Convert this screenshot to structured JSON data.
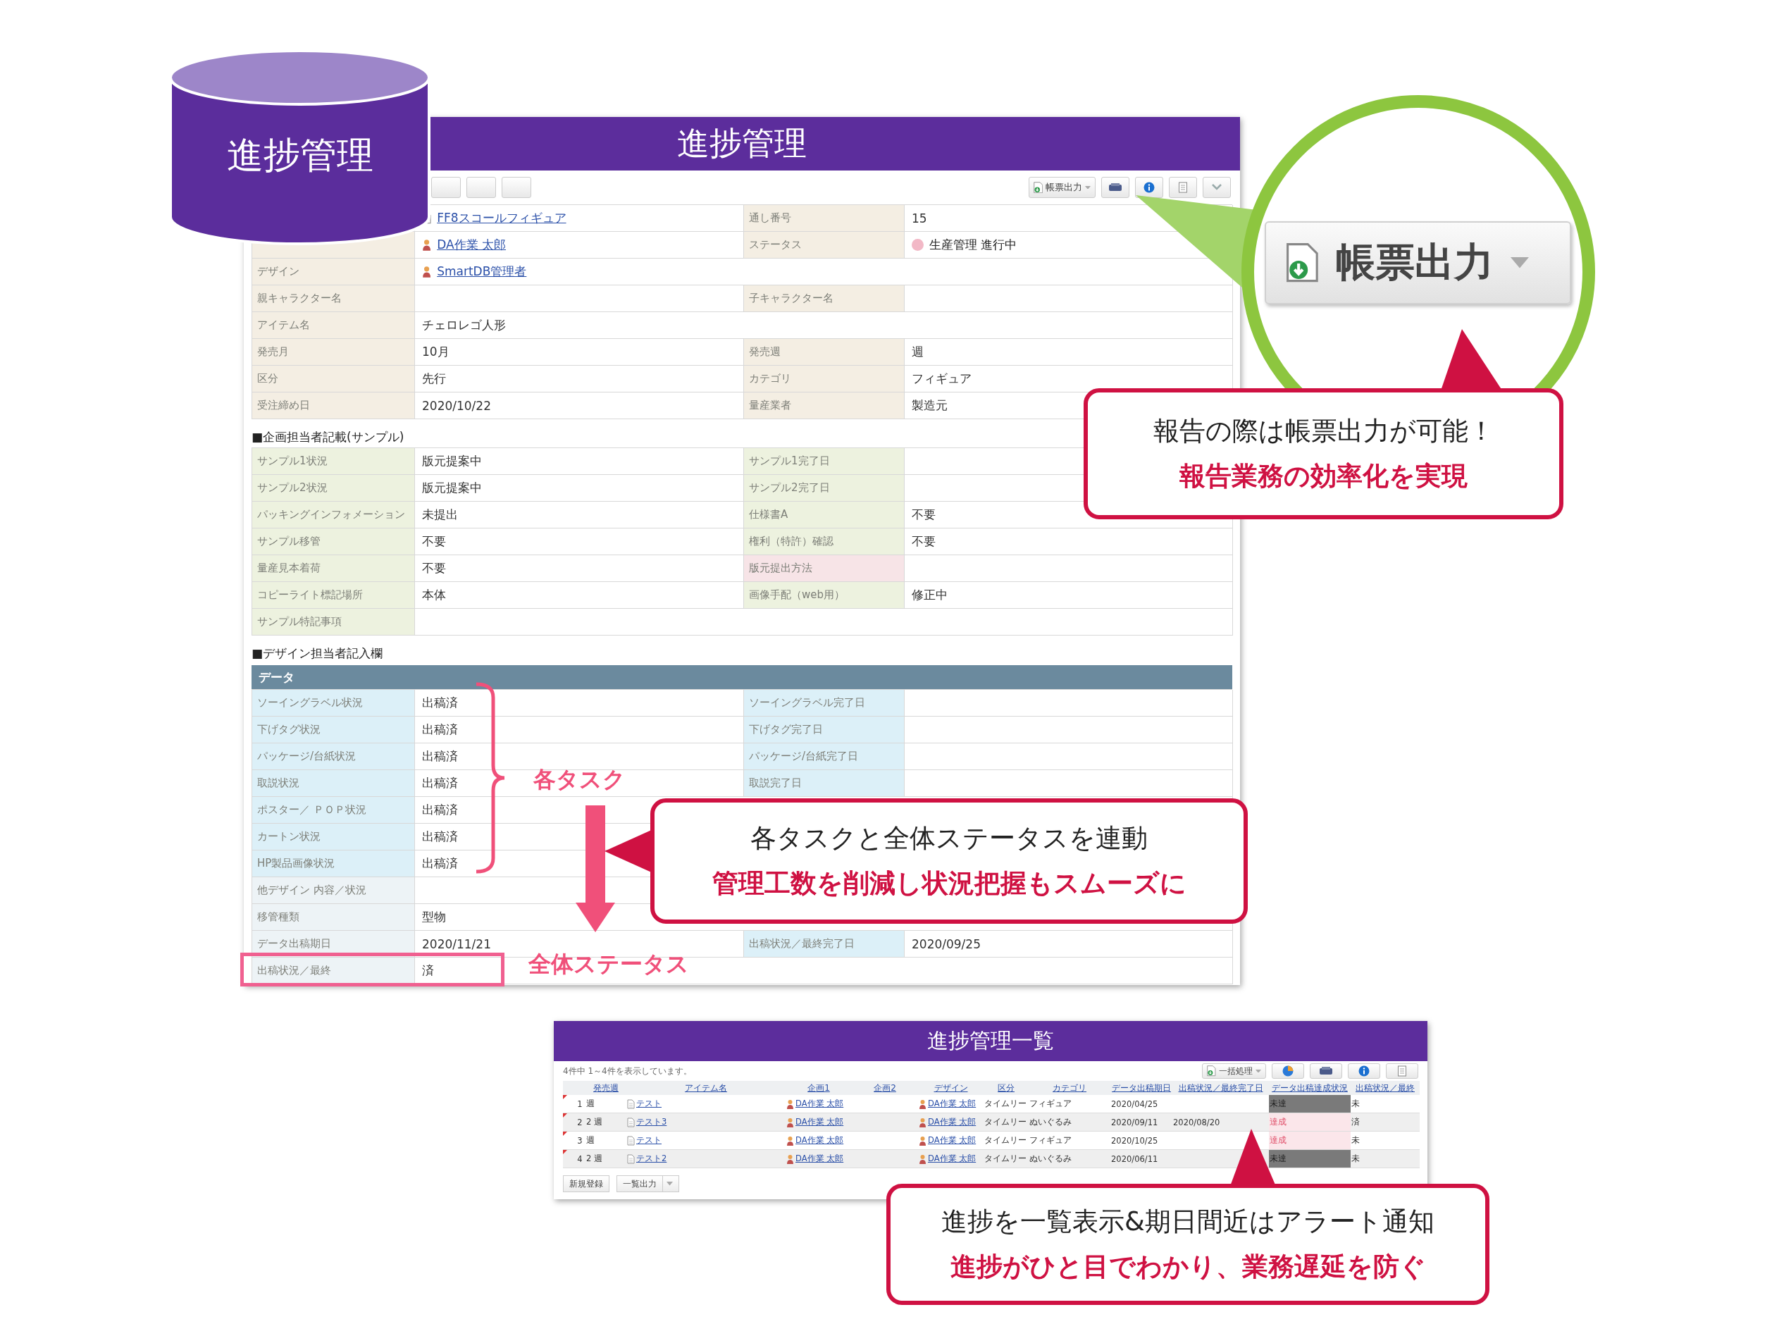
{
  "badge": {
    "title": "進捗管理"
  },
  "form": {
    "title": "進捗管理",
    "toolbar": {
      "left": [
        {
          "kind": "plain"
        },
        {
          "kind": "plain"
        },
        {
          "kind": "plain"
        }
      ],
      "right": [
        {
          "kind": "report",
          "label": "帳票出力"
        },
        {
          "kind": "print"
        },
        {
          "kind": "info"
        },
        {
          "kind": "doc"
        },
        {
          "kind": "chevron"
        }
      ]
    },
    "sections": [
      {
        "rows": [
          {
            "cells": [
              {
                "kind": "label"
              },
              {
                "kind": "doc_link",
                "text": "FF8スコールフィギュア"
              },
              {
                "kind": "label",
                "text": "通し番号",
                "color": "#f4eee3"
              },
              {
                "kind": "text",
                "text": "15"
              }
            ]
          },
          {
            "cells": [
              {
                "kind": "label",
                "color": "#f4eee3"
              },
              {
                "kind": "person_link",
                "text": "DA作業 太郎"
              },
              {
                "kind": "label",
                "text": "ステータス",
                "color": "#f4eee3"
              },
              {
                "kind": "status",
                "text": "生産管理 進行中",
                "color": "#f2b8c6"
              }
            ]
          },
          {
            "cells": [
              {
                "kind": "label",
                "text": "デザイン",
                "color": "#f4eee3"
              },
              {
                "kind": "person_link",
                "text": "SmartDB管理者"
              }
            ]
          },
          {
            "cells": [
              {
                "kind": "label",
                "text": "親キャラクター名",
                "color": "#f4eee3"
              },
              {
                "kind": "empty"
              },
              {
                "kind": "label",
                "text": "子キャラクター名",
                "color": "#f4eee3"
              },
              {
                "kind": "empty"
              }
            ]
          },
          {
            "cells": [
              {
                "kind": "label",
                "text": "アイテム名",
                "color": "#f4eee3"
              },
              {
                "kind": "text",
                "text": "チェロレゴ人形"
              }
            ]
          },
          {
            "cells": [
              {
                "kind": "label",
                "text": "発売月",
                "color": "#f4eee3"
              },
              {
                "kind": "text",
                "text": "10月"
              },
              {
                "kind": "label",
                "text": "発売週",
                "color": "#f4eee3"
              },
              {
                "kind": "text",
                "text": "週"
              }
            ]
          },
          {
            "cells": [
              {
                "kind": "label",
                "text": "区分",
                "color": "#f4eee3"
              },
              {
                "kind": "text",
                "text": "先行"
              },
              {
                "kind": "label",
                "text": "カテゴリ",
                "color": "#f4eee3"
              },
              {
                "kind": "text",
                "text": "フィギュア"
              }
            ]
          },
          {
            "cells": [
              {
                "kind": "label",
                "text": "受注締め日",
                "color": "#f4eee3"
              },
              {
                "kind": "text",
                "text": "2020/10/22"
              },
              {
                "kind": "label",
                "text": "量産業者",
                "color": "#f4eee3"
              },
              {
                "kind": "text",
                "text": "製造元"
              }
            ]
          }
        ]
      },
      {
        "heading": "■企画担当者記載(サンプル)",
        "rows": [
          {
            "cells": [
              {
                "kind": "label",
                "text": "サンプル1状況",
                "color": "#edf2df"
              },
              {
                "kind": "text",
                "text": "版元提案中"
              },
              {
                "kind": "label",
                "text": "サンプル1完了日",
                "color": "#edf2df"
              },
              {
                "kind": "empty"
              }
            ]
          },
          {
            "cells": [
              {
                "kind": "label",
                "text": "サンプル2状況",
                "color": "#edf2df"
              },
              {
                "kind": "text",
                "text": "版元提案中"
              },
              {
                "kind": "label",
                "text": "サンプル2完了日",
                "color": "#edf2df"
              },
              {
                "kind": "empty"
              }
            ]
          },
          {
            "cells": [
              {
                "kind": "label",
                "text": "パッキングインフォメーション",
                "color": "#edf2df"
              },
              {
                "kind": "text",
                "text": "未提出"
              },
              {
                "kind": "label",
                "text": "仕様書A",
                "color": "#edf2df"
              },
              {
                "kind": "text",
                "text": "不要"
              }
            ]
          },
          {
            "cells": [
              {
                "kind": "label",
                "text": "サンプル移管",
                "color": "#edf2df"
              },
              {
                "kind": "text",
                "text": "不要"
              },
              {
                "kind": "label",
                "text": "権利（特許）確認",
                "color": "#edf2df"
              },
              {
                "kind": "text",
                "text": "不要"
              }
            ]
          },
          {
            "cells": [
              {
                "kind": "label",
                "text": "量産見本着荷",
                "color": "#edf2df"
              },
              {
                "kind": "text",
                "text": "不要"
              },
              {
                "kind": "label",
                "text": "版元提出方法",
                "color": "#f7e4e7"
              },
              {
                "kind": "empty"
              }
            ]
          },
          {
            "cells": [
              {
                "kind": "label",
                "text": "コピーライト標記場所",
                "color": "#edf2df"
              },
              {
                "kind": "text",
                "text": "本体"
              },
              {
                "kind": "label",
                "text": "画像手配（web用）",
                "color": "#edf2df"
              },
              {
                "kind": "text",
                "text": "修正中"
              }
            ]
          },
          {
            "cells": [
              {
                "kind": "label",
                "text": "サンプル特記事項",
                "color": "#edf2df"
              },
              {
                "kind": "empty"
              }
            ]
          }
        ]
      },
      {
        "heading": "■デザイン担当者記入欄",
        "bar": "データ",
        "rows": [
          {
            "cells": [
              {
                "kind": "label",
                "text": "ソーイングラベル状況",
                "color": "#dcf0f8"
              },
              {
                "kind": "text",
                "text": "出稿済"
              },
              {
                "kind": "label",
                "text": "ソーイングラベル完了日",
                "color": "#dcf0f8"
              },
              {
                "kind": "empty"
              }
            ]
          },
          {
            "cells": [
              {
                "kind": "label",
                "text": "下げタグ状況",
                "color": "#dcf0f8"
              },
              {
                "kind": "text",
                "text": "出稿済"
              },
              {
                "kind": "label",
                "text": "下げタグ完了日",
                "color": "#dcf0f8"
              },
              {
                "kind": "empty"
              }
            ]
          },
          {
            "cells": [
              {
                "kind": "label",
                "text": "パッケージ/台紙状況",
                "color": "#dcf0f8"
              },
              {
                "kind": "text",
                "text": "出稿済"
              },
              {
                "kind": "label",
                "text": "パッケージ/台紙完了日",
                "color": "#dcf0f8"
              },
              {
                "kind": "empty"
              }
            ]
          },
          {
            "cells": [
              {
                "kind": "label",
                "text": "取説状況",
                "color": "#dcf0f8"
              },
              {
                "kind": "text",
                "text": "出稿済"
              },
              {
                "kind": "label",
                "text": "取説完了日",
                "color": "#dcf0f8"
              },
              {
                "kind": "empty"
              }
            ]
          },
          {
            "cells": [
              {
                "kind": "label",
                "text": "ポスター／ ＰＯＰ状況",
                "color": "#dcf0f8"
              },
              {
                "kind": "text",
                "text": "出稿済"
              }
            ]
          },
          {
            "cells": [
              {
                "kind": "label",
                "text": "カートン状況",
                "color": "#dcf0f8"
              },
              {
                "kind": "text",
                "text": "出稿済"
              }
            ]
          },
          {
            "cells": [
              {
                "kind": "label",
                "text": "HP製品画像状況",
                "color": "#dcf0f8"
              },
              {
                "kind": "text",
                "text": "出稿済"
              }
            ]
          },
          {
            "cells": [
              {
                "kind": "label",
                "text": "他デザイン 内容／状況",
                "color": "#edf3f6"
              },
              {
                "kind": "empty"
              }
            ]
          },
          {
            "cells": [
              {
                "kind": "label",
                "text": "移管種類",
                "color": "#edf3f6"
              },
              {
                "kind": "text",
                "text": "型物"
              }
            ]
          },
          {
            "cells": [
              {
                "kind": "label",
                "text": "データ出稿期日",
                "color": "#edf3f6"
              },
              {
                "kind": "text",
                "text": "2020/11/21"
              },
              {
                "kind": "label",
                "text": "出稿状況／最終完了日",
                "color": "#dcf0f8"
              },
              {
                "kind": "text",
                "text": "2020/09/25"
              }
            ]
          },
          {
            "cells": [
              {
                "kind": "label",
                "text": "出稿状況／最終",
                "color": "#edf3f6"
              },
              {
                "kind": "text",
                "text": "済"
              }
            ]
          }
        ]
      }
    ]
  },
  "annotations": {
    "tasks": "各タスク",
    "overall": "全体ステータス"
  },
  "zoom_button": {
    "label": "帳票出力"
  },
  "callouts": [
    {
      "text": "報告の際は帳票出力が可能！",
      "emphasis": "報告業務の効率化を実現"
    },
    {
      "text": "各タスクと全体ステータスを連動",
      "emphasis": "管理工数を削減し状況把握もスムーズに"
    },
    {
      "text": "進捗を一覧表示&期日間近はアラート通知",
      "emphasis": "進捗がひと目でわかり、業務遅延を防ぐ"
    }
  ],
  "list": {
    "title": "進捗管理一覧",
    "summary": "4件中 1～4件を表示しています。",
    "toolbar": [
      {
        "kind": "bulk",
        "label": "一括処理"
      },
      {
        "kind": "chart"
      },
      {
        "kind": "print"
      },
      {
        "kind": "info"
      },
      {
        "kind": "doc"
      }
    ],
    "columns": [
      {
        "label": "発売週",
        "kind": "text"
      },
      {
        "label": "アイテム名",
        "kind": "doc_link"
      },
      {
        "label": "企画1",
        "kind": "person_link"
      },
      {
        "label": "企画2",
        "kind": "person_link"
      },
      {
        "label": "デザイン",
        "kind": "person_link"
      },
      {
        "label": "区分",
        "kind": "text"
      },
      {
        "label": "カテゴリ",
        "kind": "text"
      },
      {
        "label": "データ出稿期日",
        "kind": "text"
      },
      {
        "label": "出稿状況／最終完了日",
        "kind": "text"
      },
      {
        "label": "データ出稿達成状況",
        "kind": "status"
      },
      {
        "label": "出稿状況／最終",
        "kind": "text"
      }
    ],
    "rows": [
      {
        "number": "1",
        "achieved": false,
        "cells": [
          "週",
          "テスト",
          "DA作業 太郎",
          null,
          "DA作業 太郎",
          "タイムリー",
          "フィギュア",
          "2020/04/25",
          null,
          "未達",
          "未"
        ]
      },
      {
        "number": "2",
        "achieved": true,
        "cells": [
          "2 週",
          "テスト3",
          "DA作業 太郎",
          null,
          "DA作業 太郎",
          "タイムリー",
          "ぬいぐるみ",
          "2020/09/11",
          "2020/08/20",
          "達成",
          "済"
        ]
      },
      {
        "number": "3",
        "achieved": true,
        "cells": [
          "週",
          "テスト",
          "DA作業 太郎",
          null,
          "DA作業 太郎",
          "タイムリー",
          "フィギュア",
          "2020/10/25",
          null,
          "達成",
          "未"
        ]
      },
      {
        "number": "4",
        "achieved": false,
        "cells": [
          "2 週",
          "テスト2",
          "DA作業 太郎",
          null,
          "DA作業 太郎",
          "タイムリー",
          "ぬいぐるみ",
          "2020/06/11",
          null,
          "未達",
          "未"
        ]
      }
    ],
    "buttons": [
      {
        "kind": "plain",
        "label": "新規登録"
      },
      {
        "kind": "dropdown",
        "label": "一覧出力"
      }
    ]
  }
}
